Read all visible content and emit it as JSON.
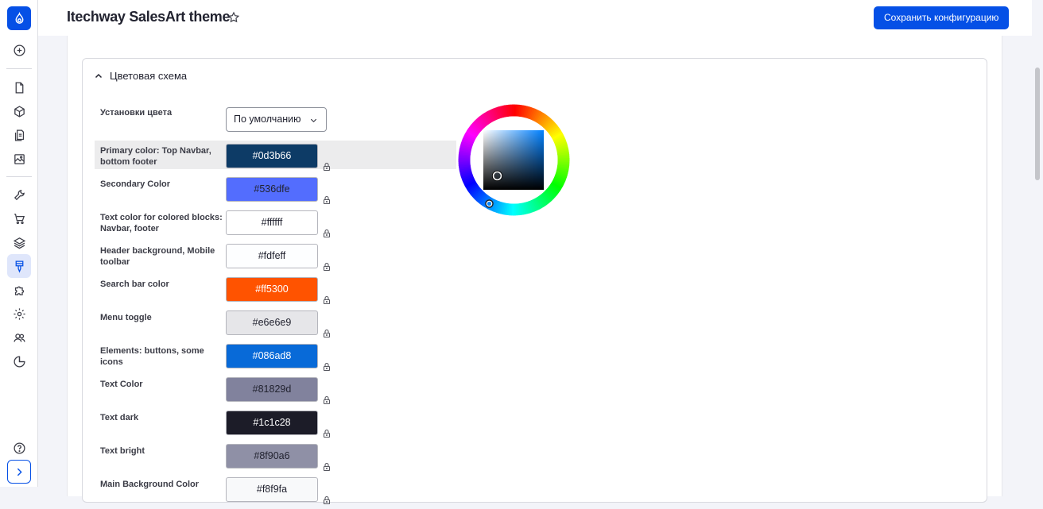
{
  "header": {
    "title": "Itechway SalesArt theme",
    "save_label": "Сохранить конфигурацию"
  },
  "section": {
    "title": "Цветовая схема"
  },
  "color_settings": {
    "label": "Установки цвета",
    "selected": "По умолчанию"
  },
  "colors": [
    {
      "label": "Primary color: Top Navbar, bottom footer",
      "value": "#0d3b66",
      "text_color": "#ffffff"
    },
    {
      "label": "Secondary Color",
      "value": "#536dfe",
      "text_color": "#222330"
    },
    {
      "label": "Text color for colored blocks: Navbar, footer",
      "value": "#ffffff",
      "text_color": "#222330"
    },
    {
      "label": "Header background, Mobile toolbar",
      "value": "#fdfeff",
      "text_color": "#222330"
    },
    {
      "label": "Search bar color",
      "value": "#ff5300",
      "text_color": "#ffffff"
    },
    {
      "label": "Menu toggle",
      "value": "#e6e6e9",
      "text_color": "#222330"
    },
    {
      "label": "Elements: buttons, some icons",
      "value": "#086ad8",
      "text_color": "#ffffff"
    },
    {
      "label": "Text Color",
      "value": "#81829d",
      "text_color": "#222330"
    },
    {
      "label": "Text dark",
      "value": "#1c1c28",
      "text_color": "#ffffff"
    },
    {
      "label": "Text bright",
      "value": "#8f90a6",
      "text_color": "#222330"
    },
    {
      "label": "Main Background Color",
      "value": "#f8f9fa",
      "text_color": "#222330"
    }
  ],
  "theme": {
    "accent": "#0550e6"
  }
}
